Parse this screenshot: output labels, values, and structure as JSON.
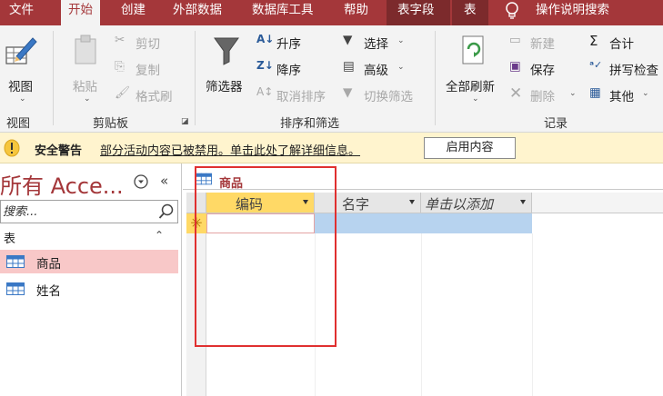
{
  "tabs": [
    "文件",
    "开始",
    "创建",
    "外部数据",
    "数据库工具",
    "帮助",
    "表字段",
    "表",
    "操作说明搜索"
  ],
  "active_tab": "开始",
  "ribbon": {
    "view": {
      "label": "视图",
      "group": "视图"
    },
    "clipboard": {
      "paste": "粘贴",
      "cut": "剪切",
      "copy": "复制",
      "format_painter": "格式刷",
      "group": "剪贴板"
    },
    "sort_filter": {
      "filter": "筛选器",
      "ascending": "升序",
      "descending": "降序",
      "remove_sort": "取消排序",
      "selection": "选择",
      "advanced": "高级",
      "toggle_filter": "切换筛选",
      "group": "排序和筛选"
    },
    "records": {
      "refresh_all": "全部刷新",
      "new": "新建",
      "save": "保存",
      "delete": "删除",
      "totals": "合计",
      "spelling": "拼写检查",
      "more": "其他",
      "group": "记录"
    }
  },
  "security_bar": {
    "title": "安全警告",
    "message": "部分活动内容已被禁用。单击此处了解详细信息。",
    "button": "启用内容"
  },
  "nav_pane": {
    "title": "所有 Acce...",
    "search_placeholder": "搜索...",
    "section": "表",
    "items": [
      "商品",
      "姓名"
    ],
    "selected": "商品"
  },
  "document": {
    "tab": "商品",
    "columns": [
      "编码",
      "名字",
      "单击以添加"
    ],
    "new_row_marker": "✳"
  },
  "colors": {
    "brand": "#a4373a",
    "highlight": "#e03030"
  }
}
